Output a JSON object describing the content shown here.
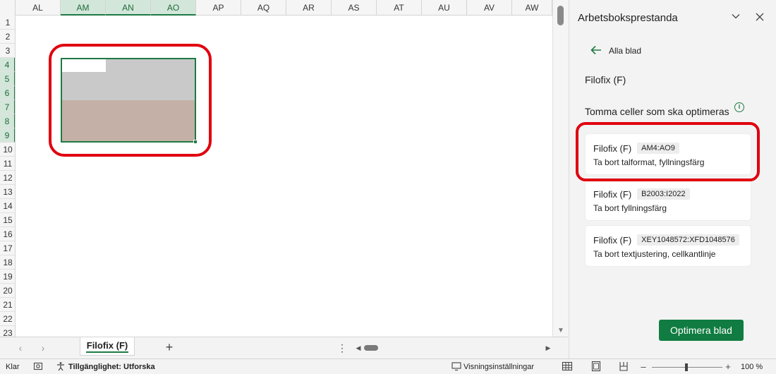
{
  "columns": [
    "AL",
    "AM",
    "AN",
    "AO",
    "AP",
    "AQ",
    "AR",
    "AS",
    "AT",
    "AU",
    "AV",
    "AW"
  ],
  "selected_columns": [
    "AM",
    "AN",
    "AO"
  ],
  "rows": [
    "1",
    "2",
    "3",
    "4",
    "5",
    "6",
    "7",
    "8",
    "9",
    "10",
    "11",
    "12",
    "13",
    "14",
    "15",
    "16",
    "17",
    "18",
    "19",
    "20",
    "21",
    "22",
    "23"
  ],
  "selected_rows": [
    "4",
    "5",
    "6",
    "7",
    "8",
    "9"
  ],
  "sheet_tabs": {
    "active": "Filofix (F)",
    "add_label": "+"
  },
  "pane": {
    "title": "Arbetsboksprestanda",
    "back_label": "Alla blad",
    "sheet_name": "Filofix (F)",
    "section_title": "Tomma celler som ska optimeras",
    "info_icon": "i",
    "cards": [
      {
        "sheet": "Filofix (F)",
        "range": "AM4:AO9",
        "description": "Ta bort talformat, fyllningsfärg"
      },
      {
        "sheet": "Filofix (F)",
        "range": "B2003:I2022",
        "description": "Ta bort fyllningsfärg"
      },
      {
        "sheet": "Filofix (F)",
        "range": "XEY1048572:XFD1048576",
        "description": "Ta bort textjustering, cellkantlinje"
      }
    ],
    "optimize_button": "Optimera blad"
  },
  "status": {
    "ready": "Klar",
    "accessibility": "Tillgänglighet: Utforska",
    "display_settings": "Visningsinställningar",
    "zoom": "100 %"
  },
  "colors": {
    "accent": "#107c41",
    "highlight": "#e0000f",
    "fill_grey": "#c9c9c9",
    "fill_brown": "#c4b0a6"
  }
}
